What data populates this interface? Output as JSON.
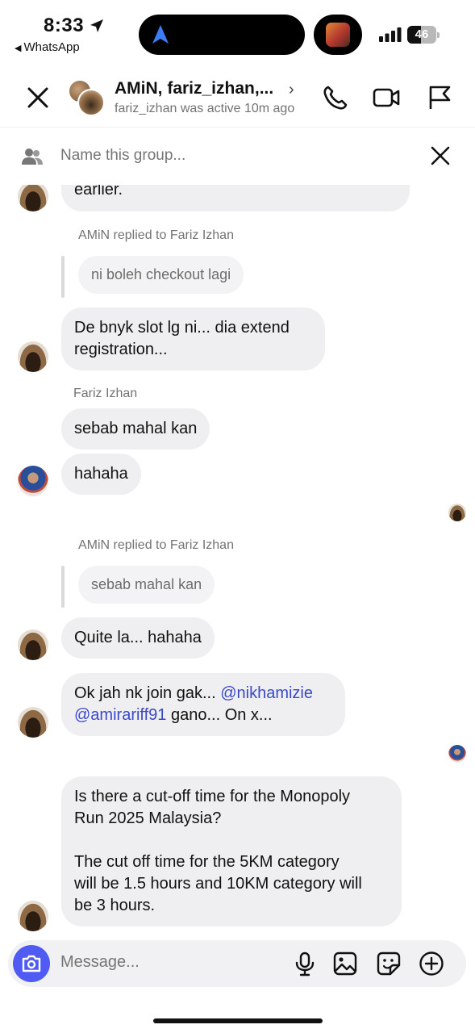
{
  "status_bar": {
    "time": "8:33",
    "back_app": "WhatsApp",
    "battery": "46"
  },
  "header": {
    "title": "AMiN, fariz_izhan,...",
    "subtitle": "fariz_izhan was active 10m ago",
    "icons": [
      "close-icon",
      "phone-icon",
      "video-icon",
      "flag-icon"
    ]
  },
  "name_bar": {
    "placeholder": "Name this group..."
  },
  "messages": {
    "m1": "earlier.",
    "reply1_meta": "AMiN replied to Fariz Izhan",
    "reply1_quote": "ni boleh checkout lagi",
    "m2_line1": "De bnyk slot lg ni... dia extend",
    "m2_line2": "registration...",
    "sender_fariz": "Fariz Izhan",
    "m3": "sebab mahal kan",
    "m4": "hahaha",
    "reply2_meta": "AMiN replied to Fariz Izhan",
    "reply2_quote": "sebab mahal kan",
    "m5": "Quite la... hahaha",
    "m6_part1": "Ok jah nk join gak... ",
    "m6_mention1": "@nikhamizie",
    "m6_mention2": "@amirariff91",
    "m6_part2": " gano... On x...",
    "m7_line1": "Is there a cut-off time for the Monopoly",
    "m7_line2": "Run 2025 Malaysia?",
    "m7_line3": "The cut off time for the 5KM category",
    "m7_line4": "will be 1.5 hours and 10KM category will",
    "m7_line5": "be 3 hours."
  },
  "composer": {
    "placeholder": "Message...",
    "icons": [
      "camera-icon",
      "microphone-icon",
      "gallery-icon",
      "sticker-icon",
      "plus-icon"
    ]
  },
  "colors": {
    "accent": "#4f5bf2",
    "bubble": "#efeff1",
    "mention": "#3b49c9"
  }
}
